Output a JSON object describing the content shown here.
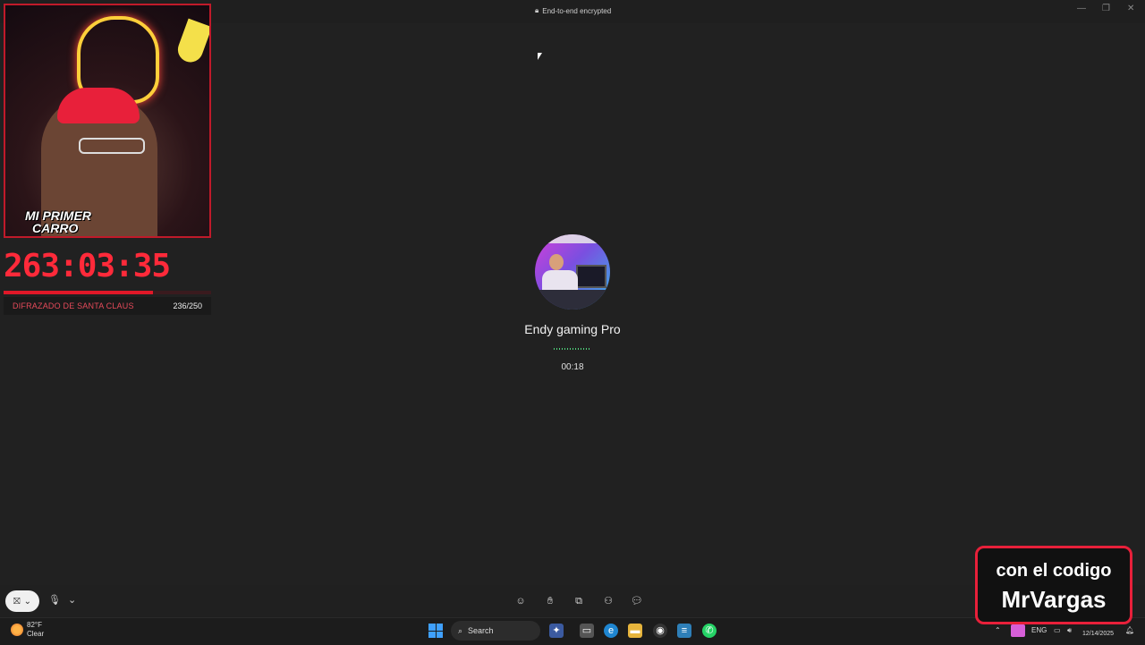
{
  "titlebar": {
    "encryption_label": "End-to-end encrypted"
  },
  "call": {
    "contact_name": "Endy gaming Pro",
    "duration": "00:18"
  },
  "overlay": {
    "webcam_caption_line1": "MI PRIMER",
    "webcam_caption_line2": "CARRO",
    "countdown": "263:03:35",
    "goal_label": "DIFRAZADO DE SANTA CLAUS",
    "goal_count": "236/250",
    "goal_progress": 0.72,
    "promo_line1": "con el codigo",
    "promo_line2": "MrVargas"
  },
  "taskbar": {
    "weather_temp": "82°F",
    "weather_condition": "Clear",
    "search_label": "Search",
    "language": "ENG",
    "date": "12/14/2025"
  },
  "colors": {
    "accent_red": "#e01828",
    "whatsapp_green": "#25d366",
    "windows_blue": "#3fa0ff"
  },
  "icons": {
    "call_controls": [
      "emoji-icon",
      "raise-hand-icon",
      "share-screen-icon",
      "add-participant-icon",
      "chat-icon"
    ]
  }
}
